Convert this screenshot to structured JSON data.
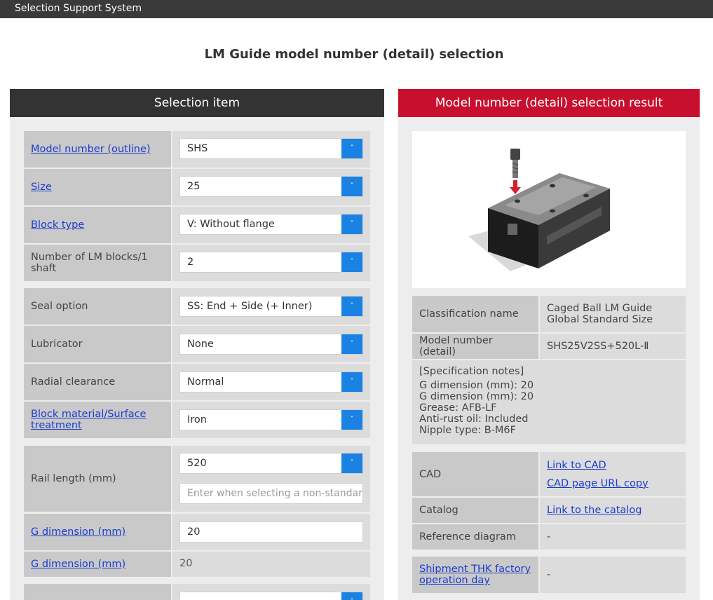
{
  "app": {
    "title": "Selection Support System"
  },
  "page": {
    "title": "LM Guide model number (detail) selection"
  },
  "left": {
    "header": "Selection item",
    "rows": [
      {
        "label": "Model number (outline)",
        "value": "SHS"
      },
      {
        "label": "Size",
        "value": "25"
      },
      {
        "label": "Block type",
        "value": "V: Without flange"
      },
      {
        "label": "Number of LM blocks/1 shaft",
        "value": "2"
      },
      {
        "label": "Seal option",
        "value": "SS: End + Side (+ Inner)"
      },
      {
        "label": "Lubricator",
        "value": "None"
      },
      {
        "label": "Radial clearance",
        "value": "Normal"
      },
      {
        "label": "Block material/Surface treatment",
        "value": "Iron"
      },
      {
        "label": "Rail length (mm)",
        "value": "520",
        "placeholder": "Enter when selecting a non-standard"
      },
      {
        "label": "G dimension (mm)",
        "value": "20"
      },
      {
        "label": "G dimension (mm)",
        "value": "20"
      },
      {
        "label": "",
        "value": ""
      }
    ]
  },
  "right": {
    "header": "Model number (detail) selection result",
    "image_alt": "LM Guide block product image",
    "classification": {
      "label": "Classification name",
      "value": "Caged Ball LM Guide Global Standard Size"
    },
    "model": {
      "label": "Model number (detail)",
      "value": "SHS25V2SS+520L-Ⅱ"
    },
    "notes": {
      "title": "[Specification notes]",
      "lines": [
        "G dimension (mm): 20",
        "G dimension (mm): 20",
        "Grease: AFB-LF",
        "Anti-rust oil: Included",
        "Nipple type: B-M6F"
      ]
    },
    "cad": {
      "label": "CAD",
      "link1": "Link to CAD",
      "link2": "CAD page URL copy"
    },
    "catalog": {
      "label": "Catalog",
      "link": "Link to the catalog"
    },
    "reference": {
      "label": "Reference diagram",
      "value": "-"
    },
    "shipment": {
      "label": "Shipment THK factory operation day",
      "value": "-"
    }
  },
  "icons": {
    "dropdown": "chevron-down-icon"
  },
  "colors": {
    "accent_red": "#c8102e",
    "dropdown_blue": "#1a82e2",
    "dark_header": "#333333"
  }
}
